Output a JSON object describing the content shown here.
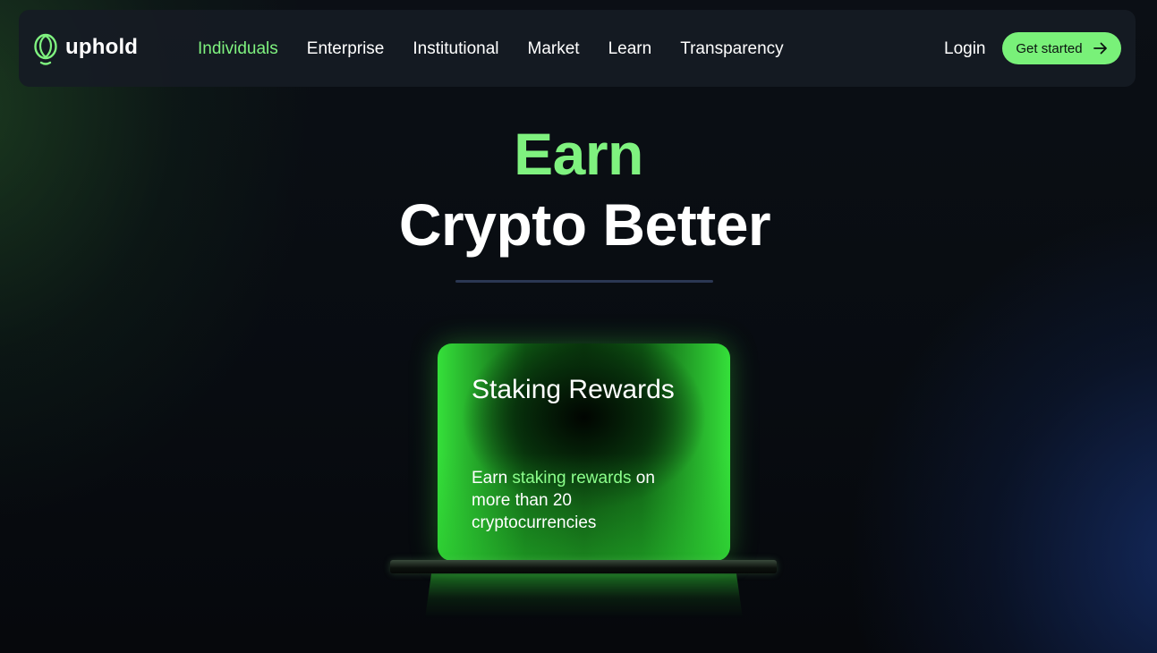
{
  "brand": {
    "name": "uphold",
    "accent": "#7ff27f"
  },
  "nav": {
    "links": [
      {
        "label": "Individuals",
        "active": true
      },
      {
        "label": "Enterprise",
        "active": false
      },
      {
        "label": "Institutional",
        "active": false
      },
      {
        "label": "Market",
        "active": false
      },
      {
        "label": "Learn",
        "active": false
      },
      {
        "label": "Transparency",
        "active": false
      }
    ],
    "login_label": "Login",
    "cta_label": "Get started",
    "cta_icon": "arrow-right-icon"
  },
  "hero": {
    "line1": "Earn",
    "line2": "Crypto Better"
  },
  "card": {
    "title": "Staking Rewards",
    "text_before": "Earn ",
    "text_highlight": "staking rewards",
    "text_after": " on more than 20 cryptocurrencies"
  }
}
